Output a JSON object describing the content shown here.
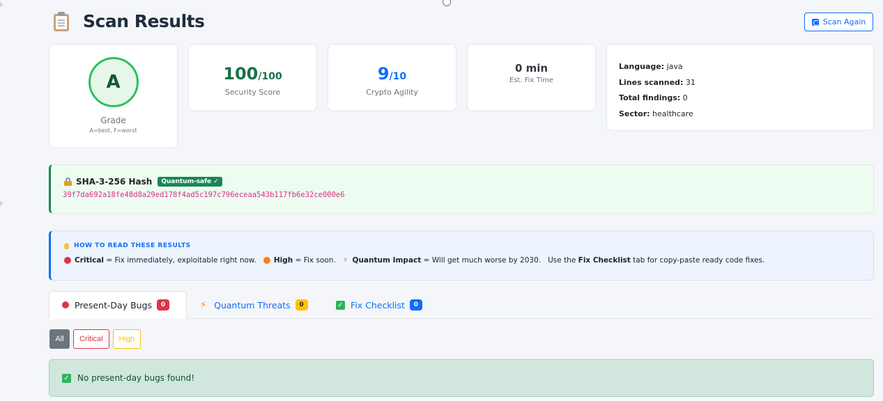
{
  "header": {
    "title": "Scan Results",
    "icon": "clipboard-icon"
  },
  "actions": {
    "scan_again_label": "Scan Again"
  },
  "grade": {
    "value": "A",
    "label": "Grade",
    "note": "A=best, F=worst"
  },
  "metrics": {
    "security": {
      "value": "100",
      "max": "/100",
      "label": "Security Score",
      "color": "#157347"
    },
    "agility": {
      "value": "9",
      "max": "/10",
      "label": "Crypto Agility",
      "color": "#0d6efd"
    },
    "fix_time": {
      "value": "0 min",
      "label": "Est. Fix Time"
    }
  },
  "info": {
    "language_label": "Language:",
    "language": " java",
    "lines_label": "Lines scanned:",
    "lines": " 31",
    "findings_label": "Total findings:",
    "findings": " 0",
    "sector_label": "Sector:",
    "sector": " healthcare"
  },
  "hash": {
    "title": "SHA-3-256 Hash",
    "badge": "Quantum-safe ✓",
    "value": "39f7da692a18fe48d8a29ed178f4ad5c197c796eceaa543b117fb6e32ce000e6"
  },
  "howto": {
    "title": "HOW TO READ THESE RESULTS",
    "critical_label": "Critical",
    "critical_desc": " = Fix immediately, exploitable right now.",
    "high_label": "High",
    "high_desc": " = Fix soon.",
    "quantum_label": "Quantum Impact",
    "quantum_desc": " = Will get much worse by 2030.",
    "checklist_prefix": "Use the ",
    "checklist_label": "Fix Checklist",
    "checklist_suffix": " tab for copy-paste ready code fixes."
  },
  "tabs": [
    {
      "label": "Present-Day Bugs",
      "count": "0"
    },
    {
      "label": "Quantum Threats",
      "count": "0"
    },
    {
      "label": "Fix Checklist",
      "count": "0"
    }
  ],
  "filters": {
    "all": "All",
    "critical": "Critical",
    "high": "High"
  },
  "empty_state": {
    "message": "No present-day bugs found!"
  }
}
